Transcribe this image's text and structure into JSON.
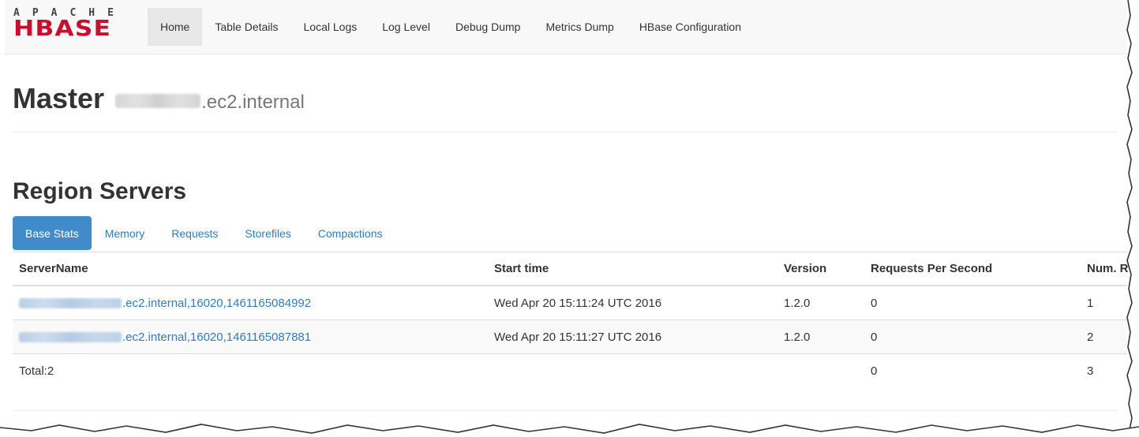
{
  "logo": {
    "top_text": "APACHE",
    "main_text": "HBASE"
  },
  "nav": {
    "items": [
      {
        "label": "Home"
      },
      {
        "label": "Table Details"
      },
      {
        "label": "Local Logs"
      },
      {
        "label": "Log Level"
      },
      {
        "label": "Debug Dump"
      },
      {
        "label": "Metrics Dump"
      },
      {
        "label": "HBase Configuration"
      }
    ]
  },
  "master": {
    "title": "Master",
    "host_suffix": ".ec2.internal"
  },
  "region_servers": {
    "title": "Region Servers",
    "tabs": [
      {
        "label": "Base Stats"
      },
      {
        "label": "Memory"
      },
      {
        "label": "Requests"
      },
      {
        "label": "Storefiles"
      },
      {
        "label": "Compactions"
      }
    ],
    "columns": [
      "ServerName",
      "Start time",
      "Version",
      "Requests Per Second",
      "Num. R"
    ],
    "rows": [
      {
        "server_suffix": ".ec2.internal,16020,1461165084992",
        "start_time": "Wed Apr 20 15:11:24 UTC 2016",
        "version": "1.2.0",
        "requests_per_second": "0",
        "num_regions": "1"
      },
      {
        "server_suffix": ".ec2.internal,16020,1461165087881",
        "start_time": "Wed Apr 20 15:11:27 UTC 2016",
        "version": "1.2.0",
        "requests_per_second": "0",
        "num_regions": "2"
      }
    ],
    "total": {
      "label": "Total:2",
      "requests_per_second": "0",
      "num_regions": "3"
    }
  },
  "colors": {
    "link": "#337ab7",
    "active_tab": "#428bca",
    "logo_red": "#c8102e",
    "navbar_bg": "#f8f8f8"
  }
}
